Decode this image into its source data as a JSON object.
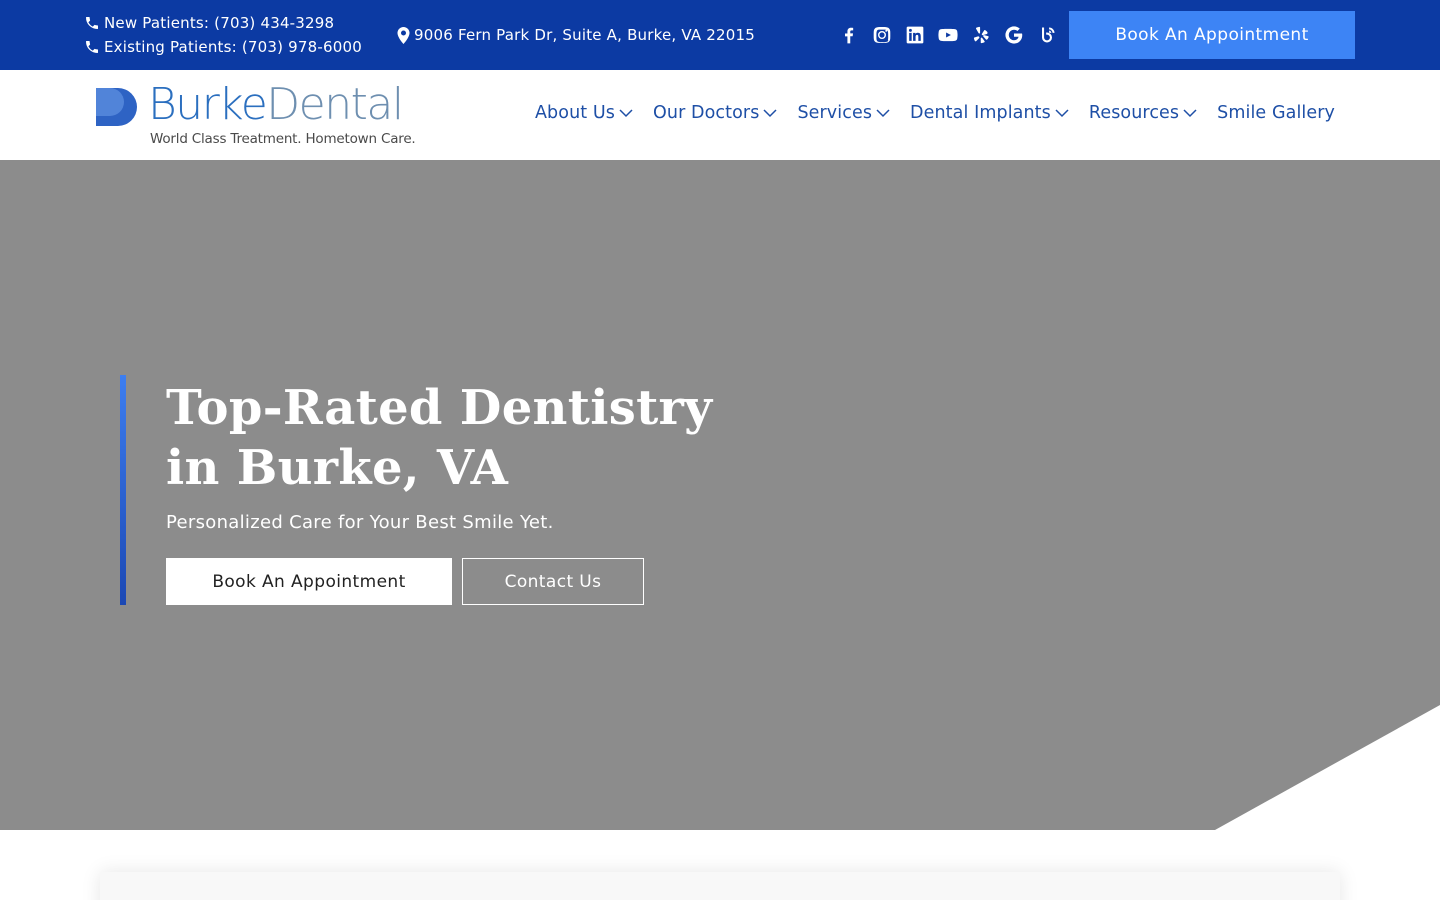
{
  "topbar": {
    "new_patients": "New Patients: (703) 434-3298",
    "existing_patients": "Existing Patients: (703) 978-6000",
    "address": "9006 Fern Park Dr, Suite A, Burke, VA 22015",
    "socials": [
      "facebook-icon",
      "instagram-icon",
      "linkedin-icon",
      "youtube-icon",
      "yelp-icon",
      "google-icon",
      "blog-icon"
    ],
    "book_label": "Book An Appointment"
  },
  "logo": {
    "name_part1": "Burke",
    "name_part2": "Dental",
    "tagline": "World Class Treatment. Hometown Care."
  },
  "nav": {
    "items": [
      {
        "label": "About Us",
        "dropdown": true
      },
      {
        "label": "Our Doctors",
        "dropdown": true
      },
      {
        "label": "Services",
        "dropdown": true
      },
      {
        "label": "Dental Implants",
        "dropdown": true
      },
      {
        "label": "Resources",
        "dropdown": true
      },
      {
        "label": "Smile Gallery",
        "dropdown": false
      }
    ]
  },
  "hero": {
    "title_line1": "Top-Rated Dentistry",
    "title_line2": "in Burke, VA",
    "subtitle": "Personalized Care for Your Best Smile Yet.",
    "book_label": "Book An Appointment",
    "contact_label": "Contact Us"
  },
  "colors": {
    "topbar_bg": "#0c3aa3",
    "accent_button": "#3d84f5",
    "nav_text": "#1e4fa6",
    "hero_bg": "#8c8c8c"
  }
}
